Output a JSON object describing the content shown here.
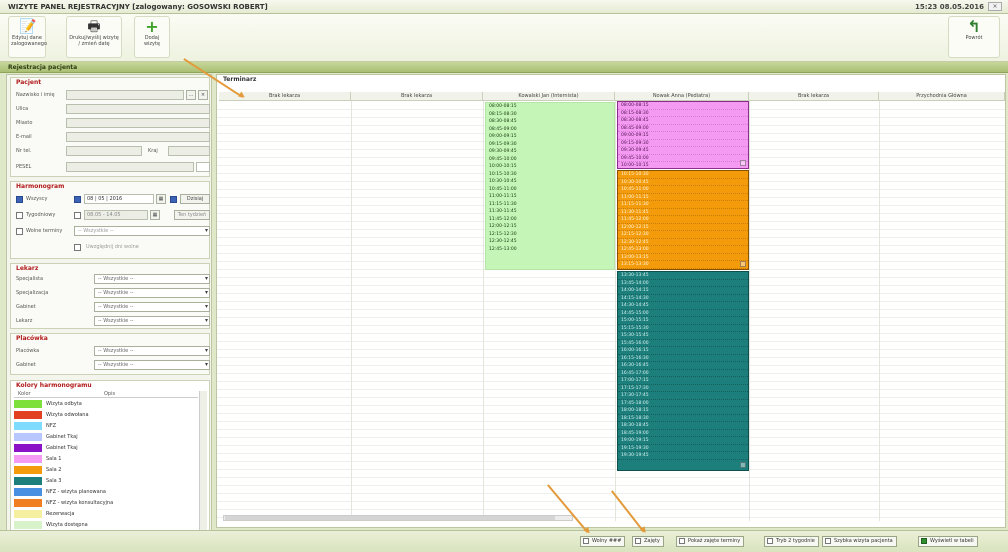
{
  "window": {
    "title": "WIZYTE PANEL REJESTRACYJNY [zalogowany: GOSOWSKI ROBERT]",
    "clock": "15:23 08.05.2016",
    "close_label": "×"
  },
  "toolbar": {
    "btn1_label": "Edytuj dane zalogowanego",
    "btn2_label": "Drukuj/wyślij wizytę / zmień datę",
    "add_label": "Dodaj wizytę",
    "back_label": "Powrót"
  },
  "section_title": "Rejestracja pacjenta",
  "left": {
    "patient_title": "Pacjent",
    "fields": [
      {
        "label": "Nazwisko i imię"
      },
      {
        "label": "Ulica"
      },
      {
        "label": "Miasto"
      },
      {
        "label": "E-mail"
      },
      {
        "label": "Nr tel.",
        "label2": "Kraj"
      },
      {
        "label": "PESEL"
      }
    ],
    "booking_title": "Harmonogram",
    "booking": {
      "opt1": "Wszyscy",
      "date_from": "08 | 05 | 2016",
      "today_btn": "Dzisiaj",
      "opt2": "Tygodniowy",
      "week_val": "08.05 - 14.05",
      "week_btn": "Ten tydzień",
      "opt3": "Wolne terminy",
      "free_val": "-- Wszystkie --",
      "extra_label": "Uwzględnij dni wolne"
    },
    "filter_title": "Lekarz",
    "filters": [
      {
        "label": "Specjalista",
        "value": "-- Wszystkie --"
      },
      {
        "label": "Specjalizacja",
        "value": "-- Wszystkie --"
      },
      {
        "label": "Gabinet",
        "value": "-- Wszystkie --"
      },
      {
        "label": "Lekarz",
        "value": "-- Wszystkie --"
      }
    ],
    "location_title": "Placówka",
    "locations": [
      {
        "label": "Placówka",
        "value": "-- Wszystkie --"
      },
      {
        "label": "Gabinet",
        "value": "-- Wszystkie --"
      }
    ],
    "legend_title": "Kolory harmonogramu",
    "legend_col1": "Kolor",
    "legend_col2": "Opis",
    "legend": [
      {
        "color": "#7ee03a",
        "text": "Wizyta odbyta"
      },
      {
        "color": "#e2411f",
        "text": "Wizyta odwołana"
      },
      {
        "color": "#7fdcff",
        "text": "NFZ"
      },
      {
        "color": "#b8c7ff",
        "text": "Gabinet Tkaj"
      },
      {
        "color": "#8c12c7",
        "text": "Gabinet Tkaj"
      },
      {
        "color": "#f59af3",
        "text": "Sala 1"
      },
      {
        "color": "#f39b0a",
        "text": "Sala 2"
      },
      {
        "color": "#1d7f7c",
        "text": "Sala 3"
      },
      {
        "color": "#4a90e2",
        "text": "NFZ - wizyta planowana"
      },
      {
        "color": "#f07e22",
        "text": "NFZ - wizyta konsultacyjna"
      },
      {
        "color": "#f5efa0",
        "text": "Rezerwacja"
      },
      {
        "color": "#d8f2c9",
        "text": "Wizyta dostępna"
      },
      {
        "color": "#cfd8f5",
        "text": ""
      }
    ]
  },
  "schedule": {
    "title": "Terminarz",
    "columns": [
      "Brak lekarza",
      "Brak lekarza",
      "Kowalski Jan (Internista)",
      "Nowak Anna (Pediatra)",
      "Brak lekarza",
      "Przychodnia Główna"
    ],
    "green_slots": [
      "08:00-08:15",
      "08:15-08:30",
      "08:30-08:45",
      "08:45-09:00",
      "09:00-09:15",
      "09:15-09:30",
      "09:30-09:45",
      "09:45-10:00",
      "10:00-10:15",
      "10:15-10:30",
      "10:30-10:45",
      "10:45-11:00",
      "11:00-11:15",
      "11:15-11:30",
      "11:30-11:45",
      "11:45-12:00",
      "12:00-12:15",
      "12:15-12:30",
      "12:30-12:45",
      "12:45-13:00"
    ],
    "pink_slots": [
      "08:00-08:15",
      "08:15-08:30",
      "08:30-08:45",
      "08:45-09:00",
      "09:00-09:15",
      "09:15-09:30",
      "09:30-09:45",
      "09:45-10:00",
      "10:00-10:15"
    ],
    "orange_slots": [
      "10:15-10:30",
      "10:30-10:45",
      "10:45-11:00",
      "11:00-11:15",
      "11:15-11:30",
      "11:30-11:45",
      "11:45-12:00",
      "12:00-12:15",
      "12:15-12:30",
      "12:30-12:45",
      "12:45-13:00",
      "13:00-13:15",
      "13:15-13:30"
    ],
    "teal_slots": [
      "13:30-13:45",
      "13:45-14:00",
      "14:00-14:15",
      "14:15-14:30",
      "14:30-14:45",
      "14:45-15:00",
      "15:00-15:15",
      "15:15-15:30",
      "15:30-15:45",
      "15:45-16:00",
      "16:00-16:15",
      "16:15-16:30",
      "16:30-16:45",
      "16:45-17:00",
      "17:00-17:15",
      "17:15-17:30",
      "17:30-17:45",
      "17:45-18:00",
      "18:00-18:15",
      "18:15-18:30",
      "18:30-18:45",
      "18:45-19:00",
      "19:00-19:15",
      "19:15-19:30",
      "19:30-19:45"
    ]
  },
  "statusbar": {
    "items": [
      {
        "label": "Wolny ###",
        "checked": false
      },
      {
        "label": "Zajęty",
        "checked": false
      },
      {
        "label": "Pokaż zajęte terminy",
        "checked": false
      },
      {
        "label": "Tryb 2 tygodnie",
        "checked": false
      },
      {
        "label": "Szybka wizyta pacjenta",
        "checked": false
      },
      {
        "label": "Wyświetl w tabeli",
        "checked": true
      }
    ]
  }
}
